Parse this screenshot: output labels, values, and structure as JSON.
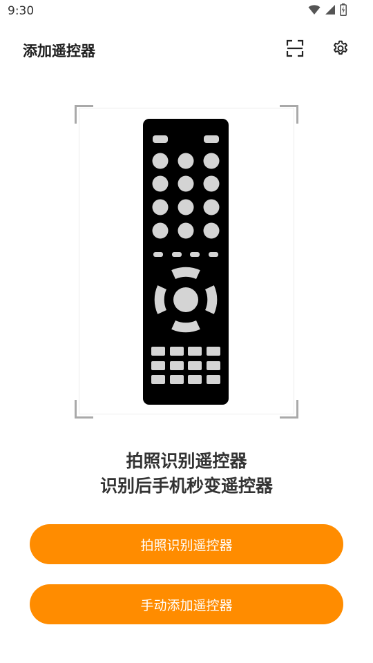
{
  "status_bar": {
    "time": "9:30",
    "icons": [
      "wifi-icon",
      "cellular-signal-icon",
      "battery-icon"
    ]
  },
  "app_bar": {
    "title": "添加遥控器",
    "actions": [
      "scan-icon",
      "settings-gear-icon"
    ]
  },
  "illustration": {
    "subject": "remote-control-illustration",
    "frame_style": "camera-corner-brackets"
  },
  "description": {
    "line1": "拍照识别遥控器",
    "line2": "识别后手机秒变遥控器"
  },
  "buttons": {
    "photo_identify": "拍照识别遥控器",
    "manual_add": "手动添加遥控器"
  },
  "colors": {
    "accent": "#ff8c00",
    "button_text": "#ffffff",
    "remote_body": "#000000",
    "remote_keys": "#d4d4d4",
    "frame_corners": "#a9a9a9"
  }
}
